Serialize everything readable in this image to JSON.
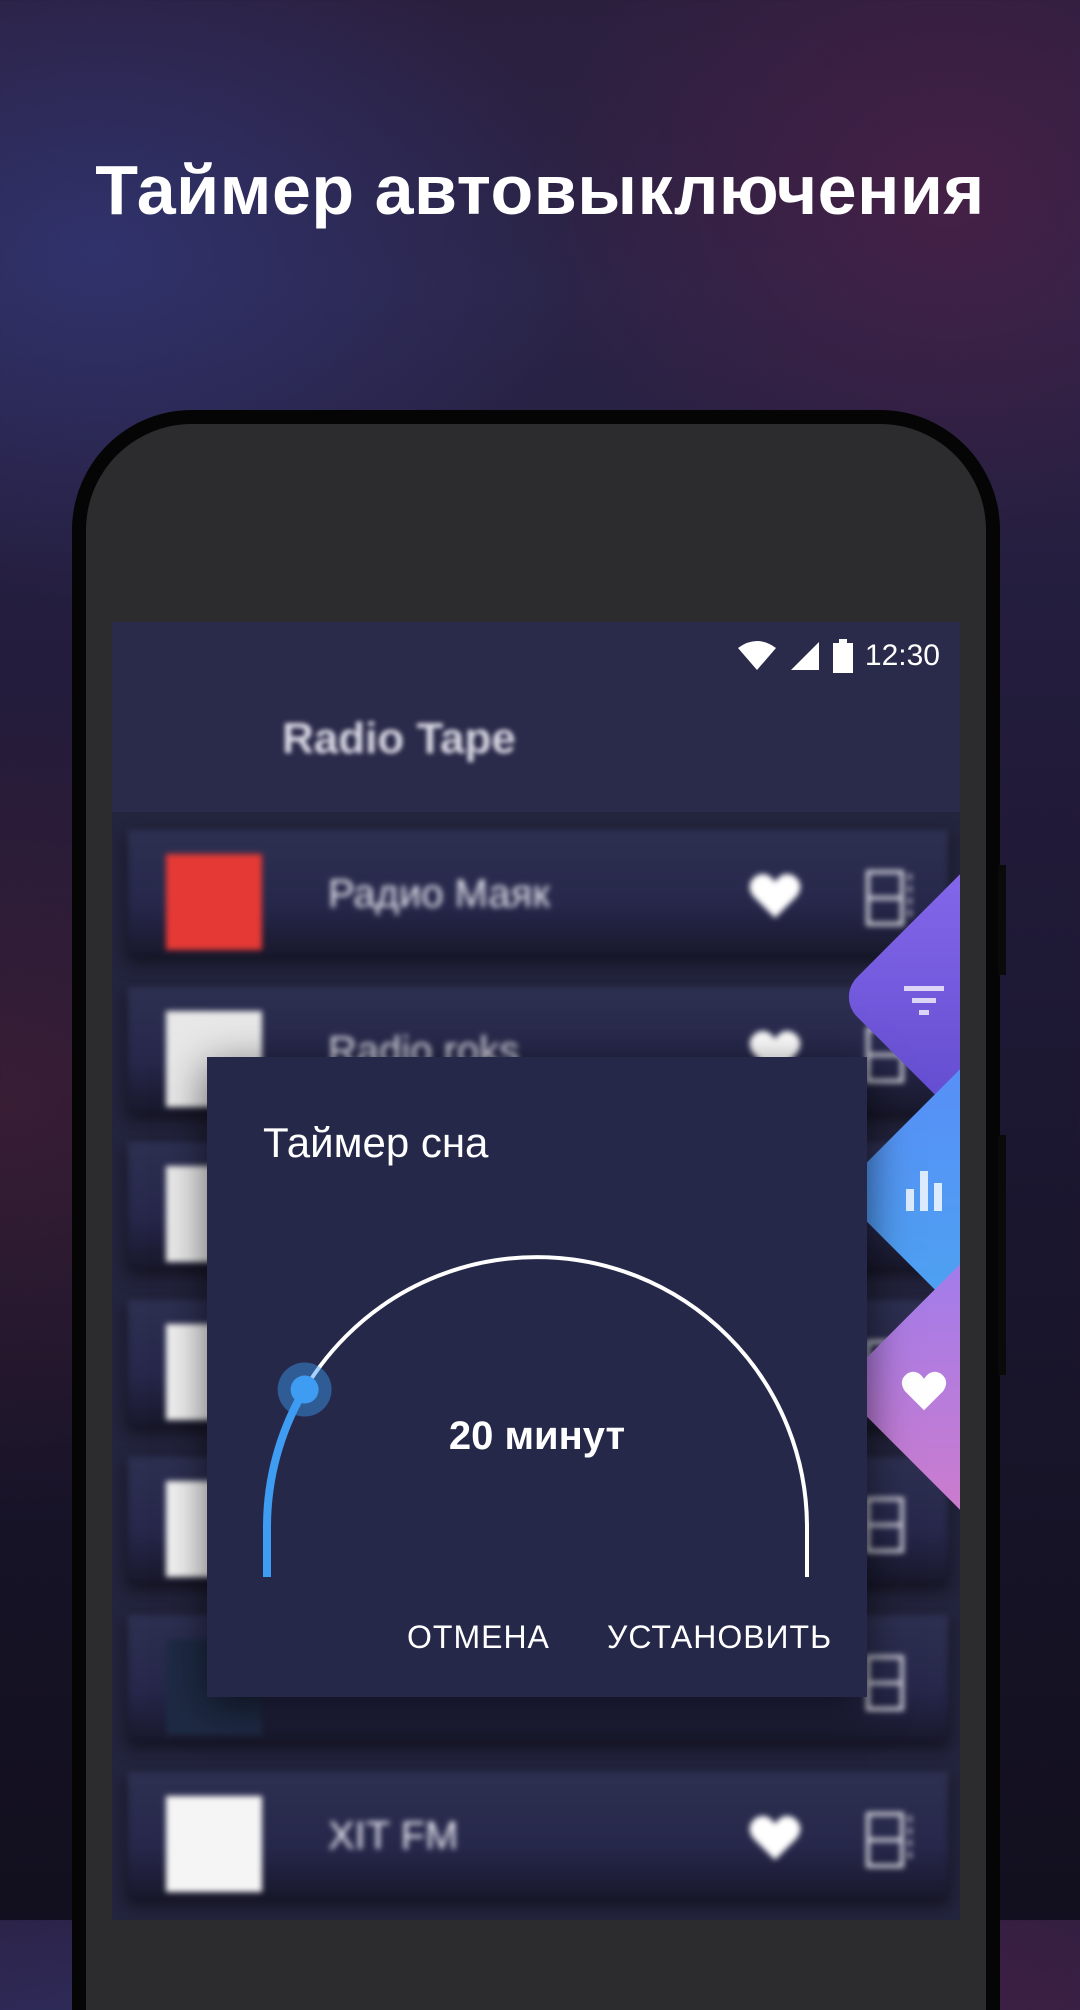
{
  "headline": "Таймер автовыключения",
  "status_bar": {
    "time": "12:30",
    "icons": [
      "wifi-icon",
      "signal-icon",
      "battery-icon"
    ]
  },
  "app": {
    "title": "Radio Tape"
  },
  "stations": [
    {
      "name": "Радио Маяк",
      "logo_color": "#e53935"
    },
    {
      "name": "Radio roks",
      "logo_color": "#e8e8e8"
    },
    {
      "name": "",
      "logo_color": "#eaeaea"
    },
    {
      "name": "",
      "logo_color": "#f0f0f0"
    },
    {
      "name": "",
      "logo_color": "#f2f2f2"
    },
    {
      "name": "",
      "logo_color": "#1e2a44"
    },
    {
      "name": "XIT FM",
      "logo_color": "#f5f5f5"
    }
  ],
  "side_tabs": [
    {
      "icon": "filter-icon"
    },
    {
      "icon": "equalizer-icon"
    },
    {
      "icon": "heart-icon"
    }
  ],
  "dialog": {
    "title": "Таймер сна",
    "value_text": "20 минут",
    "progress_fraction": 0.17,
    "cancel_label": "ОТМЕНА",
    "set_label": "УСТАНОВИТЬ"
  },
  "colors": {
    "accent": "#3f9cf3",
    "dialog_bg": "#26284a",
    "screen_bg": "#23243d"
  }
}
